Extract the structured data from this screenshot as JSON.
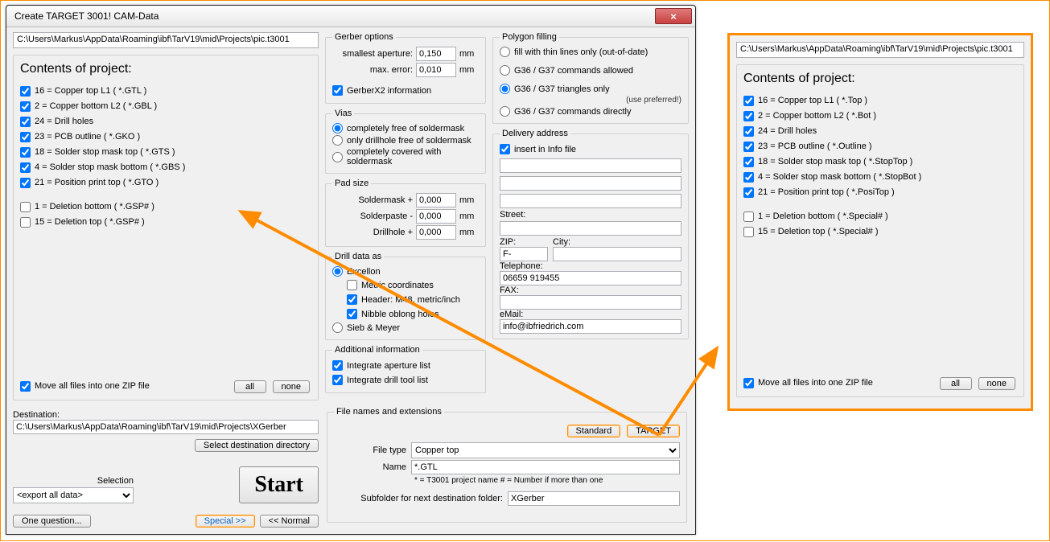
{
  "window": {
    "title": "Create TARGET 3001! CAM-Data",
    "close_glyph": "×"
  },
  "path_main": "C:\\Users\\Markus\\AppData\\Roaming\\ibf\\TarV19\\mid\\Projects\\pic.t3001",
  "contents": {
    "heading": "Contents of project:",
    "items_left": [
      {
        "checked": true,
        "label": "16 = Copper top L1   ( *.GTL )"
      },
      {
        "checked": true,
        "label": "2 = Copper bottom L2   ( *.GBL )"
      },
      {
        "checked": true,
        "label": "24 = Drill holes"
      },
      {
        "checked": true,
        "label": "23 = PCB outline   ( *.GKO )"
      },
      {
        "checked": true,
        "label": "18 = Solder stop mask top   ( *.GTS )"
      },
      {
        "checked": true,
        "label": "4 = Solder stop mask bottom   ( *.GBS )"
      },
      {
        "checked": true,
        "label": "21 = Position print top   ( *.GTO )"
      }
    ],
    "items_left2": [
      {
        "checked": false,
        "label": "1 = Deletion bottom   ( *.GSP# )"
      },
      {
        "checked": false,
        "label": "15 = Deletion top   ( *.GSP# )"
      }
    ],
    "items_right": [
      {
        "checked": true,
        "label": "16 = Copper top L1   ( *.Top )"
      },
      {
        "checked": true,
        "label": "2 = Copper bottom L2   ( *.Bot )"
      },
      {
        "checked": true,
        "label": "24 = Drill holes"
      },
      {
        "checked": true,
        "label": "23 = PCB outline   ( *.Outline )"
      },
      {
        "checked": true,
        "label": "18 = Solder stop mask top   ( *.StopTop )"
      },
      {
        "checked": true,
        "label": "4 = Solder stop mask bottom   ( *.StopBot )"
      },
      {
        "checked": true,
        "label": "21 = Position print top   ( *.PosiTop )"
      }
    ],
    "items_right2": [
      {
        "checked": false,
        "label": "1 = Deletion bottom   ( *.Special# )"
      },
      {
        "checked": false,
        "label": "15 = Deletion top   ( *.Special# )"
      }
    ]
  },
  "zip_label": "Move all files into one ZIP file",
  "btn_all": "all",
  "btn_none": "none",
  "destination_label": "Destination:",
  "destination_value": "C:\\Users\\Markus\\AppData\\Roaming\\ibf\\TarV19\\mid\\Projects\\XGerber",
  "btn_select_dest": "Select destination directory",
  "selection_label": "Selection",
  "selection_value": "<export all data>",
  "btn_start": "Start",
  "btn_one_question": "One question...",
  "btn_special": "Special >>",
  "btn_normal": "<<  Normal",
  "gerber_opts": {
    "legend": "Gerber options",
    "smallest_label": "smallest aperture:",
    "smallest_value": "0,150",
    "maxerr_label": "max. error:",
    "maxerr_value": "0,010",
    "unit": "mm",
    "x2_label": "GerberX2 information"
  },
  "vias": {
    "legend": "Vias",
    "o1": "completely free of soldermask",
    "o2": "only drillhole free of soldermask",
    "o3": "completely covered with soldermask"
  },
  "padsize": {
    "legend": "Pad size",
    "soldermask": "Soldermask  +",
    "solderpaste": "Solderpaste  -",
    "drillhole": "Drillhole  +",
    "val": "0,000",
    "unit": "mm"
  },
  "drill": {
    "legend": "Drill data as",
    "excellon": "Excellon",
    "metric": "Metric coordinates",
    "header": "Header: M48, metric/inch",
    "nibble": "Nibble oblong holes",
    "sieb": "Sieb & Meyer"
  },
  "addl": {
    "legend": "Additional information",
    "aperture": "Integrate aperture list",
    "drilltool": "Integrate drill tool list"
  },
  "polyfill": {
    "legend": "Polygon filling",
    "o1": "fill with thin lines only (out-of-date)",
    "o2": "G36 / G37 commands allowed",
    "o3": "G36 / G37 triangles only",
    "o3_note": "(use preferred!)",
    "o4": "G36 / G37 commands directly"
  },
  "delivery": {
    "legend": "Delivery address",
    "insert_label": "insert in Info file",
    "street": "Street:",
    "zip": "ZIP:",
    "zip_val": "F-",
    "city": "City:",
    "tel": "Telephone:",
    "tel_val": "06659 919455",
    "fax": "FAX:",
    "email": "eMail:",
    "email_val": "info@ibfriedrich.com"
  },
  "filenames": {
    "legend": "File names and extensions",
    "btn_standard": "Standard",
    "btn_target": "TARGET",
    "filetype_label": "File type",
    "filetype_value": "Copper top",
    "name_label": "Name",
    "name_value": "*.GTL",
    "hint": "* = T3001 project name           # = Number if more than one",
    "subfolder_label": "Subfolder for next destination folder:",
    "subfolder_value": "XGerber"
  }
}
